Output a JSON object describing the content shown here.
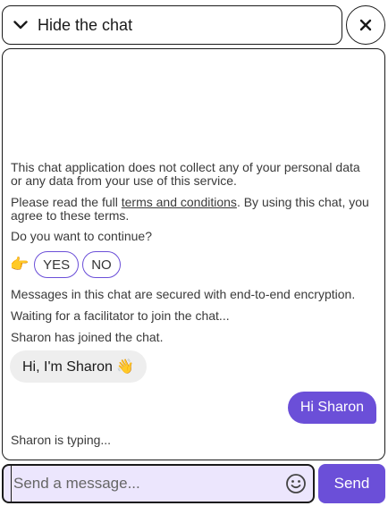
{
  "header": {
    "hide_label": "Hide the chat",
    "icons": {
      "hide": "chevron-down-icon",
      "close": "close-icon"
    }
  },
  "chat": {
    "privacy_notice": "This chat application does not collect any of your personal data or any data from your use of this service.",
    "terms_prefix": "Please read the full ",
    "terms_link": "terms and conditions",
    "terms_suffix": ". By using this chat, you agree to these terms.",
    "continue_question": "Do you want to continue?",
    "pointer_emoji": "👉",
    "yes_label": "YES",
    "no_label": "NO",
    "encryption_notice": "Messages in this chat are secured with end-to-end encryption.",
    "waiting_notice": "Waiting for a facilitator to join the chat...",
    "joined_notice": "Sharon has joined the chat.",
    "incoming_message": "Hi, I'm Sharon 👋",
    "outgoing_message": "Hi Sharon",
    "typing_indicator": "Sharon is typing..."
  },
  "composer": {
    "placeholder": "Send a message...",
    "value": "",
    "send_label": "Send",
    "emoji_icon": "smiley-icon"
  },
  "colors": {
    "accent": "#6b4fd8",
    "input_background": "#ece6fd",
    "incoming_bubble": "#eeeeee",
    "border": "#1a1a1a"
  }
}
